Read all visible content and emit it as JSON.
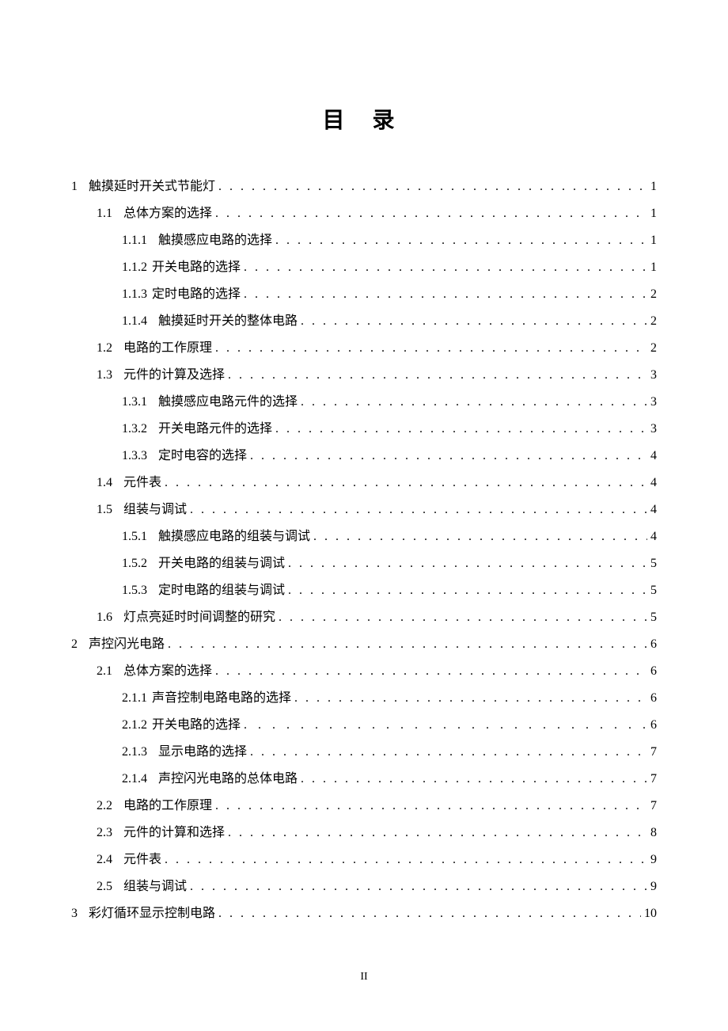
{
  "title": "目 录",
  "page_footer": "II",
  "dots": ". . . . . . . . . . . . . . . . . . . . . . . . . . . . . . . . . . . . . . . . . . . . . . . . . . . . . . . . . . . . . . . . . . . . . . . . . . . . . . . . . . . . . . . . . . . . . . . . . . . . . . . . . . . . . . . . . . .",
  "entries": [
    {
      "level": 1,
      "num": "1",
      "text": "触摸延时开关式节能灯",
      "page": "1"
    },
    {
      "level": 2,
      "num": "1.1",
      "text": "总体方案的选择",
      "page": "1"
    },
    {
      "level": 3,
      "num": "1.1.1",
      "text": "触摸感应电路的选择",
      "page": "1"
    },
    {
      "level": 3,
      "num": "1.1.2",
      "text": "开关电路的选择",
      "page": "1",
      "tight": true
    },
    {
      "level": 3,
      "num": "1.1.3",
      "text": "定时电路的选择",
      "page": "2",
      "tight": true
    },
    {
      "level": 3,
      "num": "1.1.4",
      "text": "触摸延时开关的整体电路",
      "page": "2"
    },
    {
      "level": 2,
      "num": "1.2",
      "text": "电路的工作原理",
      "page": "2"
    },
    {
      "level": 2,
      "num": "1.3",
      "text": "元件的计算及选择",
      "page": "3"
    },
    {
      "level": 3,
      "num": "1.3.1",
      "text": "触摸感应电路元件的选择",
      "page": "3"
    },
    {
      "level": 3,
      "num": "1.3.2",
      "text": "开关电路元件的选择",
      "page": "3"
    },
    {
      "level": 3,
      "num": "1.3.3",
      "text": "定时电容的选择",
      "page": "4"
    },
    {
      "level": 2,
      "num": "1.4",
      "text": "元件表",
      "page": "4"
    },
    {
      "level": 2,
      "num": "1.5",
      "text": "组装与调试",
      "page": "4"
    },
    {
      "level": 3,
      "num": "1.5.1",
      "text": "触摸感应电路的组装与调试",
      "page": "4"
    },
    {
      "level": 3,
      "num": "1.5.2",
      "text": "开关电路的组装与调试",
      "page": "5"
    },
    {
      "level": 3,
      "num": "1.5.3",
      "text": "定时电路的组装与调试",
      "page": "5"
    },
    {
      "level": 2,
      "num": "1.6",
      "text": "灯点亮延时时间调整的研究",
      "page": "5"
    },
    {
      "level": 1,
      "num": "2",
      "text": "声控闪光电路",
      "page": "6"
    },
    {
      "level": 2,
      "num": "2.1",
      "text": "总体方案的选择",
      "page": "6"
    },
    {
      "level": 3,
      "num": "2.1.1",
      "text": "声音控制电路电路的选择",
      "page": "6",
      "tight": true
    },
    {
      "level": 3,
      "num": "2.1.2",
      "text": "开关电路的选择",
      "page": "6",
      "tight": true,
      "wide": true
    },
    {
      "level": 3,
      "num": "2.1.3",
      "text": "显示电路的选择",
      "page": "7"
    },
    {
      "level": 3,
      "num": "2.1.4",
      "text": "声控闪光电路的总体电路",
      "page": "7"
    },
    {
      "level": 2,
      "num": "2.2",
      "text": "电路的工作原理",
      "page": "7"
    },
    {
      "level": 2,
      "num": "2.3",
      "text": "元件的计算和选择",
      "page": "8"
    },
    {
      "level": 2,
      "num": "2.4",
      "text": "元件表",
      "page": "9"
    },
    {
      "level": 2,
      "num": "2.5",
      "text": "组装与调试",
      "page": "9"
    },
    {
      "level": 1,
      "num": "3",
      "text": "彩灯循环显示控制电路",
      "page": "10"
    }
  ]
}
